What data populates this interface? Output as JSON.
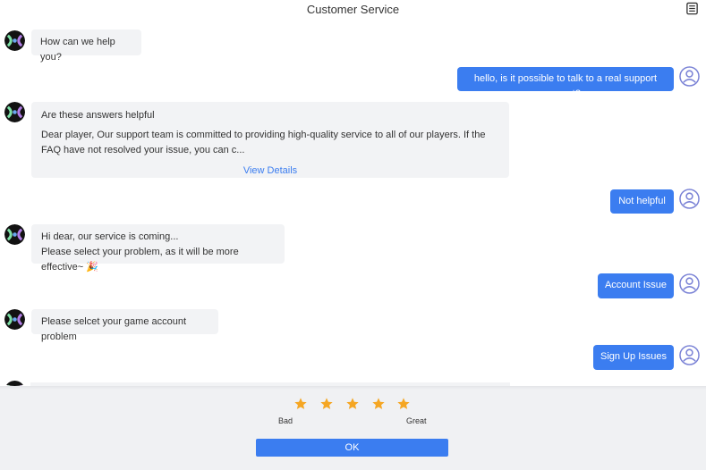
{
  "header": {
    "title": "Customer Service",
    "doc_icon": "document-icon"
  },
  "messages": {
    "m1": "How can we help you?",
    "m2": "hello, is it possible to talk to a real support agent?",
    "m3_title": "Are these answers helpful",
    "m3_body": "Dear player, Our support team is committed to providing high-quality service to all of our players. If the FAQ have not resolved your issue, you can c...",
    "m3_link": "View Details",
    "m4": "Not helpful",
    "m5_line1": "Hi dear, our service is coming...",
    "m5_line2": "Please select your problem, as it will be more effective~ 🎉",
    "m6": "Account Issue",
    "m7": "Please selcet your game account problem",
    "m8": "Sign Up Issues"
  },
  "rating": {
    "stars": 5,
    "selected": 5,
    "label_low": "Bad",
    "label_high": "Great",
    "ok_label": "OK",
    "star_color": "#f5a623"
  },
  "colors": {
    "accent": "#3b7df0",
    "bot_bubble": "#f2f3f5"
  }
}
